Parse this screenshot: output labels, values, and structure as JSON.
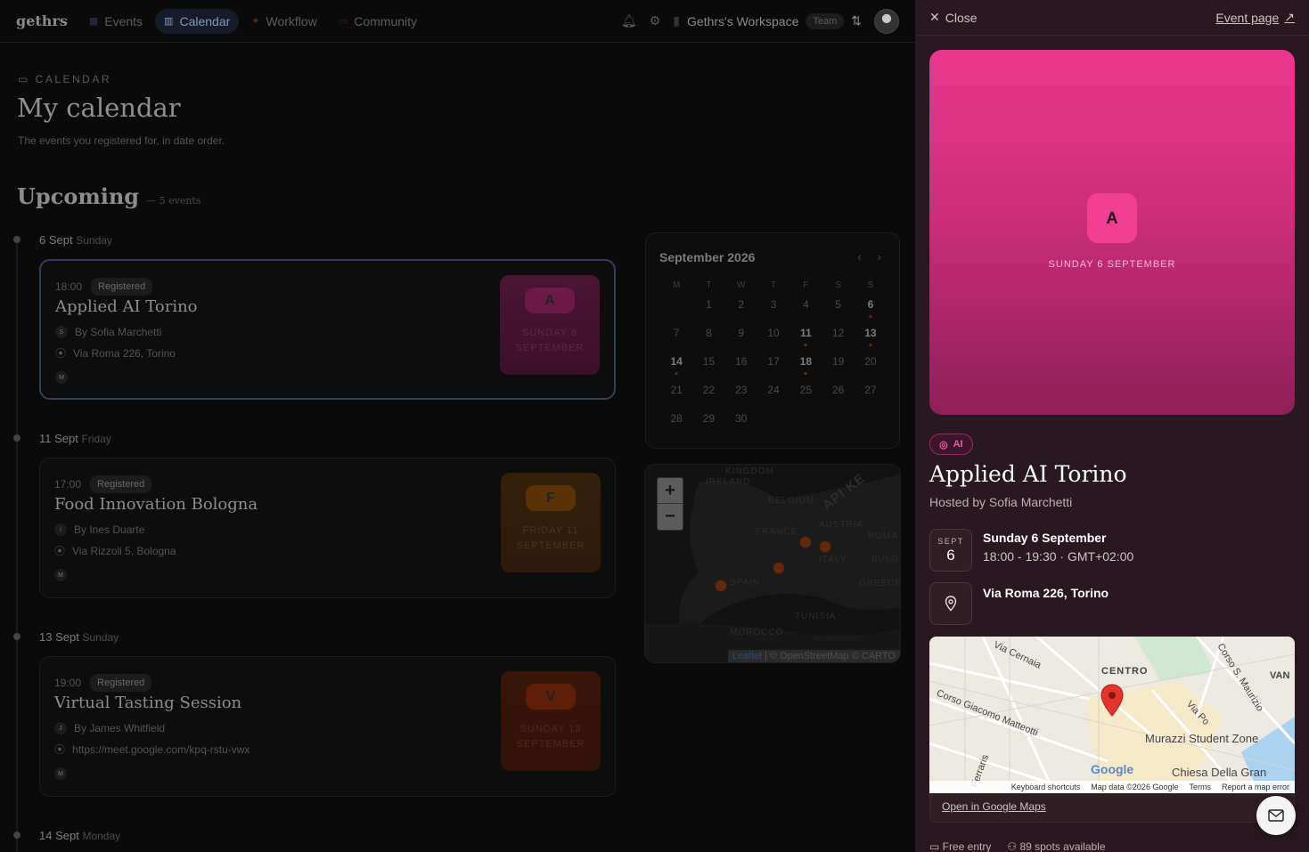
{
  "nav": {
    "logo": "gethrs",
    "items": [
      {
        "label": "Events",
        "icon": "calendar-icon",
        "active": false
      },
      {
        "label": "Calendar",
        "icon": "calendar-grid-icon",
        "active": true
      },
      {
        "label": "Workflow",
        "icon": "sparkle-icon",
        "active": false
      },
      {
        "label": "Community",
        "icon": "briefcase-icon",
        "active": false
      }
    ],
    "workspace": "Gethrs's Workspace",
    "team_badge": "Team"
  },
  "page": {
    "kicker": "CALENDAR",
    "title": "My calendar",
    "subtitle": "The events you registered for, in date order.",
    "section_title": "Upcoming",
    "section_count": "— 5 events"
  },
  "days": [
    {
      "date": "6 Sept",
      "weekday": "Sunday"
    },
    {
      "date": "11 Sept",
      "weekday": "Friday"
    },
    {
      "date": "13 Sept",
      "weekday": "Sunday"
    },
    {
      "date": "14 Sept",
      "weekday": "Monday"
    }
  ],
  "events": [
    {
      "time": "18:00",
      "status": "Registered",
      "title": "Applied AI Torino",
      "host_initial": "S",
      "host": "By Sofia Marchetti",
      "location": "Via Roma 226, Torino",
      "attendee_initial": "M",
      "thumb_letter": "A",
      "thumb_date_1": "SUNDAY 6",
      "thumb_date_2": "SEPTEMBER",
      "theme": "pink"
    },
    {
      "time": "17:00",
      "status": "Registered",
      "title": "Food Innovation Bologna",
      "host_initial": "I",
      "host": "By Ines Duarte",
      "location": "Via Rizzoli 5, Bologna",
      "attendee_initial": "M",
      "thumb_letter": "F",
      "thumb_date_1": "FRIDAY 11",
      "thumb_date_2": "SEPTEMBER",
      "theme": "orange"
    },
    {
      "time": "19:00",
      "status": "Registered",
      "title": "Virtual Tasting Session",
      "host_initial": "J",
      "host": "By James Whitfield",
      "location": "https://meet.google.com/kpq-rstu-vwx",
      "attendee_initial": "M",
      "thumb_letter": "V",
      "thumb_date_1": "SUNDAY 13",
      "thumb_date_2": "SEPTEMBER",
      "theme": "red"
    }
  ],
  "mini_calendar": {
    "title": "September 2026",
    "prev": "‹",
    "next": "›",
    "weekdays": [
      "M",
      "T",
      "W",
      "T",
      "F",
      "S",
      "S"
    ],
    "leading_blanks": 1,
    "days_in_month": 30,
    "highlighted": [
      6,
      11,
      13,
      14,
      18
    ],
    "event_days": [
      6,
      11,
      13,
      14,
      18
    ]
  },
  "event_map": {
    "zoom_in": "+",
    "zoom_out": "−",
    "labels": [
      "KINGDOM",
      "IRELAND",
      "BELGIUM",
      "FRANCE",
      "AUSTRIA",
      "ITALY",
      "SPAIN",
      "ROMA",
      "BULG",
      "GREECE",
      "TUNISIA",
      "MOROCCO",
      "API KE"
    ],
    "attribution_leaflet": "Leaflet",
    "attribution_rest": "| © OpenStreetMap © CARTO"
  },
  "panel": {
    "close_label": "Close",
    "event_page_label": "Event page",
    "hero_letter": "A",
    "hero_date": "SUNDAY 6 SEPTEMBER",
    "category": "AI",
    "title": "Applied AI Torino",
    "host": "Hosted by Sofia Marchetti",
    "date_month": "SEPT",
    "date_day": "6",
    "date_full": "Sunday 6 September",
    "time_range": "18:00 - 19:30 · GMT+02:00",
    "address": "Via Roma 226, Torino",
    "google_map": {
      "labels": [
        "CENTRO",
        "Via Cernaia",
        "Corso Giacomo Matteotti",
        "Via Po",
        "Corso S. Maurizio",
        "Murazzi Student Zone",
        "Chiesa Della Gran",
        "VAN",
        "Ferraris"
      ],
      "logo": "Google",
      "footer": [
        "Keyboard shortcuts",
        "Map data ©2026 Google",
        "Terms",
        "Report a map error"
      ]
    },
    "open_maps": "Open in Google Maps",
    "entry": "Free entry",
    "spots": "89 spots available"
  },
  "colors": {
    "accent": "#e9378e",
    "panel_bg": "#27191f",
    "selected_border": "#314158"
  }
}
